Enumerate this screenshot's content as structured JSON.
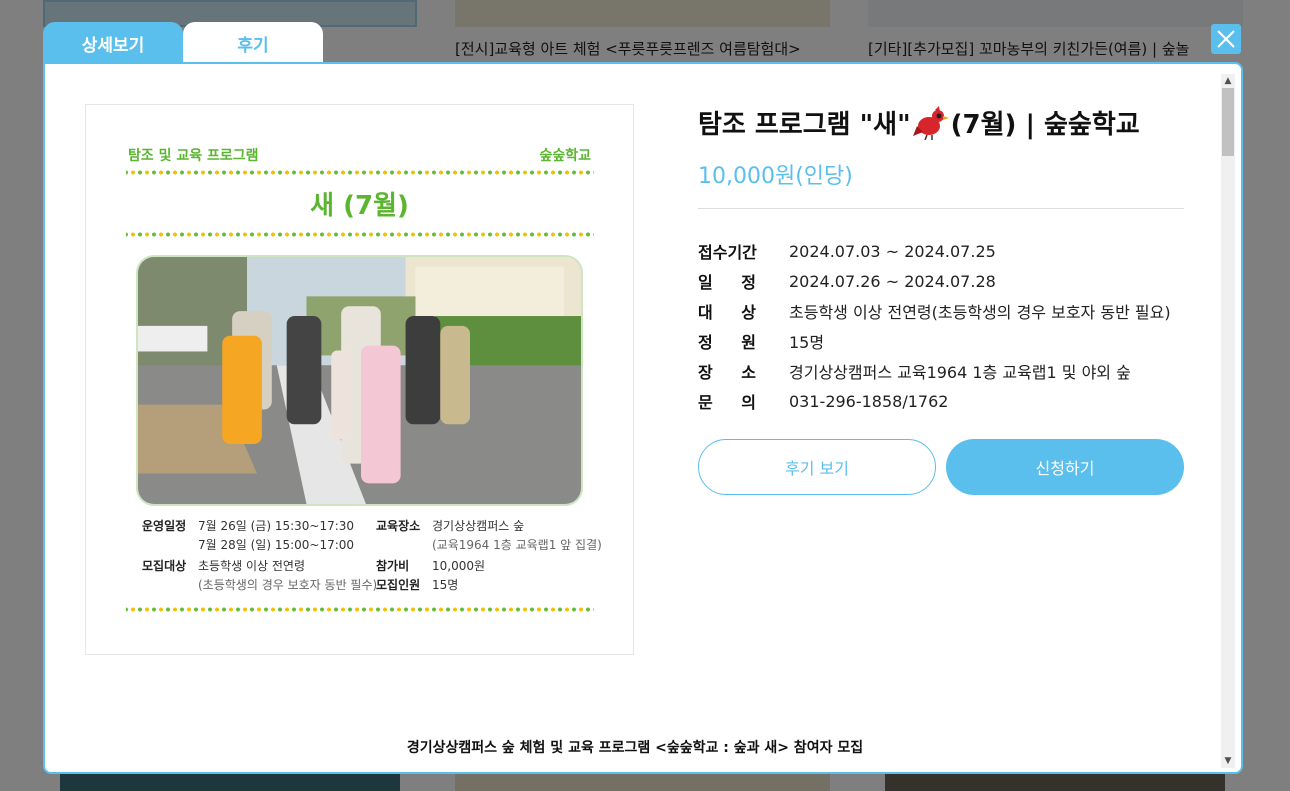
{
  "background": {
    "card2_title": "[전시]교육형 아트 체험 <푸릇푸릇프렌즈 여름탐험대>",
    "card3_title": "[기타][추가모집] 꼬마농부의 키친가든(여름) | 숲놀"
  },
  "tabs": [
    {
      "label": "상세보기",
      "active": true
    },
    {
      "label": "후기",
      "active": false
    }
  ],
  "close_icon": "close-icon",
  "poster": {
    "top_left": "탐조 및 교육 프로그램",
    "top_right": "숲숲학교",
    "title": "새 (7월)",
    "info": {
      "schedule_key": "운영일정",
      "schedule_line1": "7월 26일 (금)  15:30~17:30",
      "schedule_line2": "7월 28일 (일)  15:00~17:00",
      "target_key": "모집대상",
      "target_line1": "초등학생 이상 전연령",
      "target_line2": "(초등학생의 경우 보호자 동반 필수)",
      "place_key": "교육장소",
      "place_line1": "경기상상캠퍼스 숲",
      "place_line2": "(교육1964 1층 교육랩1 앞 집결)",
      "fee_key": "참가비",
      "fee_val": "10,000원",
      "capacity_key": "모집인원",
      "capacity_val": "15명"
    }
  },
  "program": {
    "title_before": "탐조 프로그램 \"새\"",
    "title_after": "(7월) | 숲숲학교",
    "bird_icon": "red-bird-icon",
    "price": "10,000원(인당)",
    "rows": [
      {
        "key": "접수기간",
        "value": "2024.07.03 ~ 2024.07.25"
      },
      {
        "key_a": "일",
        "key_b": "정",
        "value": "2024.07.26 ~ 2024.07.28"
      },
      {
        "key_a": "대",
        "key_b": "상",
        "value": "초등학생 이상 전연령(초등학생의 경우 보호자 동반 필요)"
      },
      {
        "key_a": "정",
        "key_b": "원",
        "value": "15명"
      },
      {
        "key_a": "장",
        "key_b": "소",
        "value": "경기상상캠퍼스 교육1964 1층 교육랩1 및 야외 숲"
      },
      {
        "key_a": "문",
        "key_b": "의",
        "value": "031-296-1858/1762"
      }
    ],
    "review_button": "후기 보기",
    "apply_button": "신청하기",
    "description": "경기상상캠퍼스 숲 체험 및 교육 프로그램 <숲숲학교 : 숲과 새> 참여자 모집"
  },
  "colors": {
    "accent": "#5bbfed",
    "poster_green": "#5cb531",
    "poster_yellow": "#f2c200"
  }
}
